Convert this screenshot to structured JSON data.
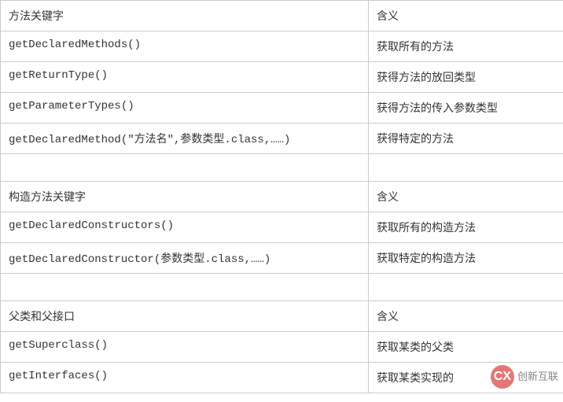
{
  "chart_data": {
    "type": "table",
    "sections": [
      {
        "header": [
          "方法关键字",
          "含义"
        ],
        "rows": [
          [
            "getDeclaredMethods()",
            "获取所有的方法"
          ],
          [
            "getReturnType()",
            "获得方法的放回类型"
          ],
          [
            "getParameterTypes()",
            "获得方法的传入参数类型"
          ],
          [
            "getDeclaredMethod(\"方法名\",参数类型.class,……)",
            "获得特定的方法"
          ]
        ]
      },
      {
        "header": [
          "构造方法关键字",
          "含义"
        ],
        "rows": [
          [
            "getDeclaredConstructors()",
            "获取所有的构造方法"
          ],
          [
            "getDeclaredConstructor(参数类型.class,……)",
            "获取特定的构造方法"
          ]
        ]
      },
      {
        "header": [
          "父类和父接口",
          "含义"
        ],
        "rows": [
          [
            "getSuperclass()",
            "获取某类的父类"
          ],
          [
            "getInterfaces()",
            "获取某类实现的"
          ]
        ]
      }
    ]
  },
  "table": {
    "r0c0": "方法关键字",
    "r0c1": "含义",
    "r1c0": "getDeclaredMethods()",
    "r1c1": "获取所有的方法",
    "r2c0": "getReturnType()",
    "r2c1": "获得方法的放回类型",
    "r3c0": "getParameterTypes()",
    "r3c1": "获得方法的传入参数类型",
    "r4c0": "getDeclaredMethod(\"方法名\",参数类型.class,……)",
    "r4c1": "获得特定的方法",
    "r5c0": "",
    "r5c1": "",
    "r6c0": "构造方法关键字",
    "r6c1": "含义",
    "r7c0": "getDeclaredConstructors()",
    "r7c1": "获取所有的构造方法",
    "r8c0": "getDeclaredConstructor(参数类型.class,……)",
    "r8c1": "获取特定的构造方法",
    "r9c0": "",
    "r9c1": "",
    "r10c0": "父类和父接口",
    "r10c1": "含义",
    "r11c0": "getSuperclass()",
    "r11c1": "获取某类的父类",
    "r12c0": "getInterfaces()",
    "r12c1": "获取某类实现的"
  },
  "watermark": {
    "badge": "CX",
    "line1": "创新互联"
  }
}
